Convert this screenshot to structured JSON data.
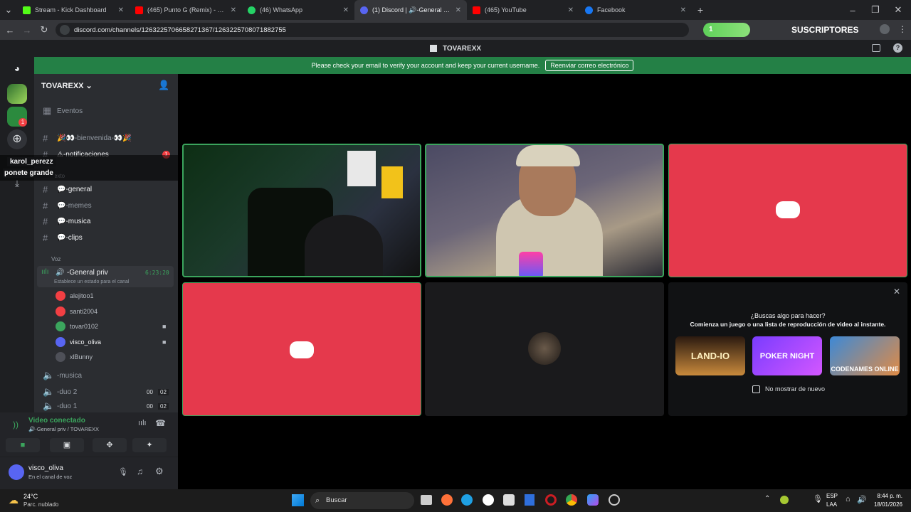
{
  "browser": {
    "tabs": [
      {
        "title": "Stream - Kick Dashboard",
        "color": "#53fc18"
      },
      {
        "title": "(465) Punto G (Remix) - Brytiago",
        "color": "#ff0000"
      },
      {
        "title": "(46) WhatsApp",
        "color": "#25d366"
      },
      {
        "title": "(1) Discord | 🔊-General priv",
        "color": "#5865f2"
      },
      {
        "title": "(465) YouTube",
        "color": "#ff0000"
      },
      {
        "title": "Facebook",
        "color": "#1877f2"
      }
    ],
    "url": "discord.com/channels/1263225706658271367/1263225708071882755",
    "overlay_count": "1",
    "overlay_label": "SUSCRIPTORES"
  },
  "discord": {
    "window_title": "TOVAREXX",
    "banner": {
      "text": "Please check your email to verify your account and keep your current username.",
      "button": "Reenviar correo electrónico"
    },
    "server_name": "TOVAREXX",
    "rail_badge": "1",
    "tooltip_user": "karol_perezz",
    "tooltip_caption": "ponete grande",
    "events_label": "Eventos",
    "channels": {
      "bienvenida": "🎉👀-bienvenida-👀🎉",
      "notificaciones": "⚠-notificaciones",
      "notif_badge": "1",
      "texto_category": "Texto",
      "general": "💬-general",
      "memes": "💬-memes",
      "musica": "💬-musica",
      "clips": "💬-clips",
      "voz_category": "Voz",
      "general_priv": "-General priv",
      "general_priv_time": "6:23:20",
      "general_priv_status": "Establece un estado para el canal",
      "voice_musica": "-musica",
      "duo2": "-duo 2",
      "duo1": "-duo 1",
      "duo_a": "00",
      "duo_b": "02"
    },
    "voice_users": [
      "alejitoo1",
      "santi2004",
      "tovar0102",
      "visco_oliva",
      "xlBunny"
    ],
    "voice_panel": {
      "status": "Video conectado",
      "channel": "🔊-General priv / TOVAREXX"
    },
    "user": {
      "name": "visco_oliva",
      "status": "En el canal de voz"
    },
    "activity": {
      "title": "¿Buscas algo para hacer?",
      "subtitle": "Comienza un juego o una lista de reproducción de video al instante.",
      "games": [
        "LAND-IO",
        "POKER NIGHT",
        "CODENAMES ONLINE"
      ],
      "checkbox": "No mostrar de nuevo"
    }
  },
  "taskbar": {
    "weather_temp": "24°C",
    "weather_desc": "Parc. nublado",
    "search": "Buscar",
    "lang": "ESP",
    "lang2": "LAA",
    "time": "8:44 p. m.",
    "date": "18/01/2026"
  }
}
